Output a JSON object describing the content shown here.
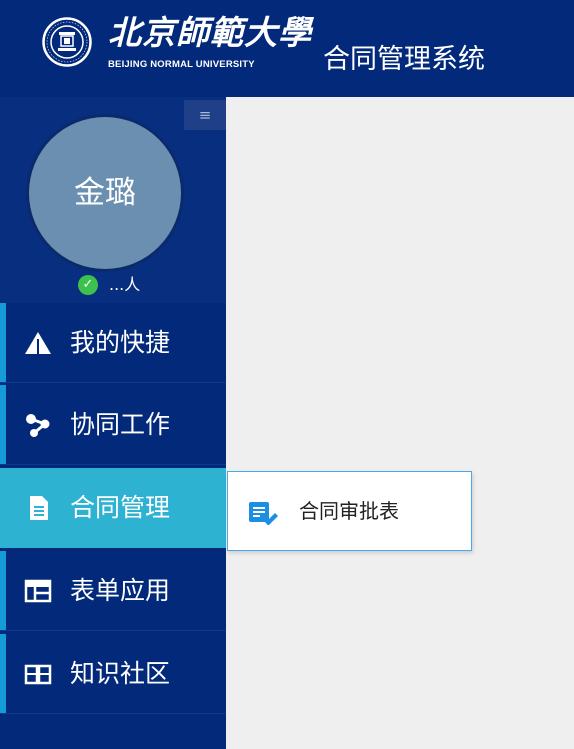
{
  "header": {
    "logo_cn": "北京師範大學",
    "logo_en": "BEIJING NORMAL UNIVERSITY",
    "title": "合同管理系统"
  },
  "profile": {
    "toggle_icon": "≡",
    "avatar_name": "金璐",
    "status_icon": "✓",
    "status_text": "...人"
  },
  "menu": {
    "items": [
      {
        "label": "我的快捷",
        "icon": "warning-triangle-icon"
      },
      {
        "label": "协同工作",
        "icon": "share-nodes-icon"
      },
      {
        "label": "合同管理",
        "icon": "document-icon",
        "active": true
      },
      {
        "label": "表单应用",
        "icon": "form-table-icon"
      },
      {
        "label": "知识社区",
        "icon": "book-icon"
      }
    ]
  },
  "submenu": {
    "items": [
      {
        "label": "合同审批表",
        "icon": "edit-list-icon"
      }
    ]
  },
  "colors": {
    "header_bg": "#03297a",
    "sidebar_bg": "#03297a",
    "active_bg": "#2eb2d2",
    "indicator": "#159bd6",
    "content_bg": "#efefef",
    "submenu_border": "#4aa8ec",
    "submenu_icon": "#1a8fe3"
  }
}
